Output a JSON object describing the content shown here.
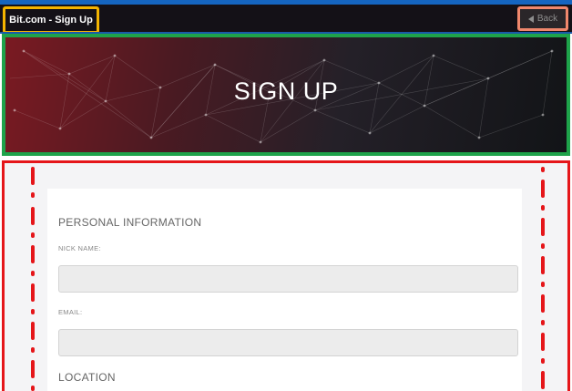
{
  "navbar": {
    "title": "Bit.com - Sign Up",
    "back_label": "Back",
    "back_icon": "triangle-left-icon"
  },
  "hero": {
    "title": "SIGN UP"
  },
  "form": {
    "personal_heading": "PERSONAL INFORMATION",
    "nick_label": "NICK NAME:",
    "nick_value": "",
    "email_label": "EMAIL:",
    "email_value": "",
    "location_heading": "LOCATION"
  },
  "colors": {
    "title_outline": "#f4b400",
    "back_outline": "#f0876c",
    "hero_outline": "#1ea34a",
    "form_outline": "#e5161a",
    "top_strip": "#1565c0"
  }
}
